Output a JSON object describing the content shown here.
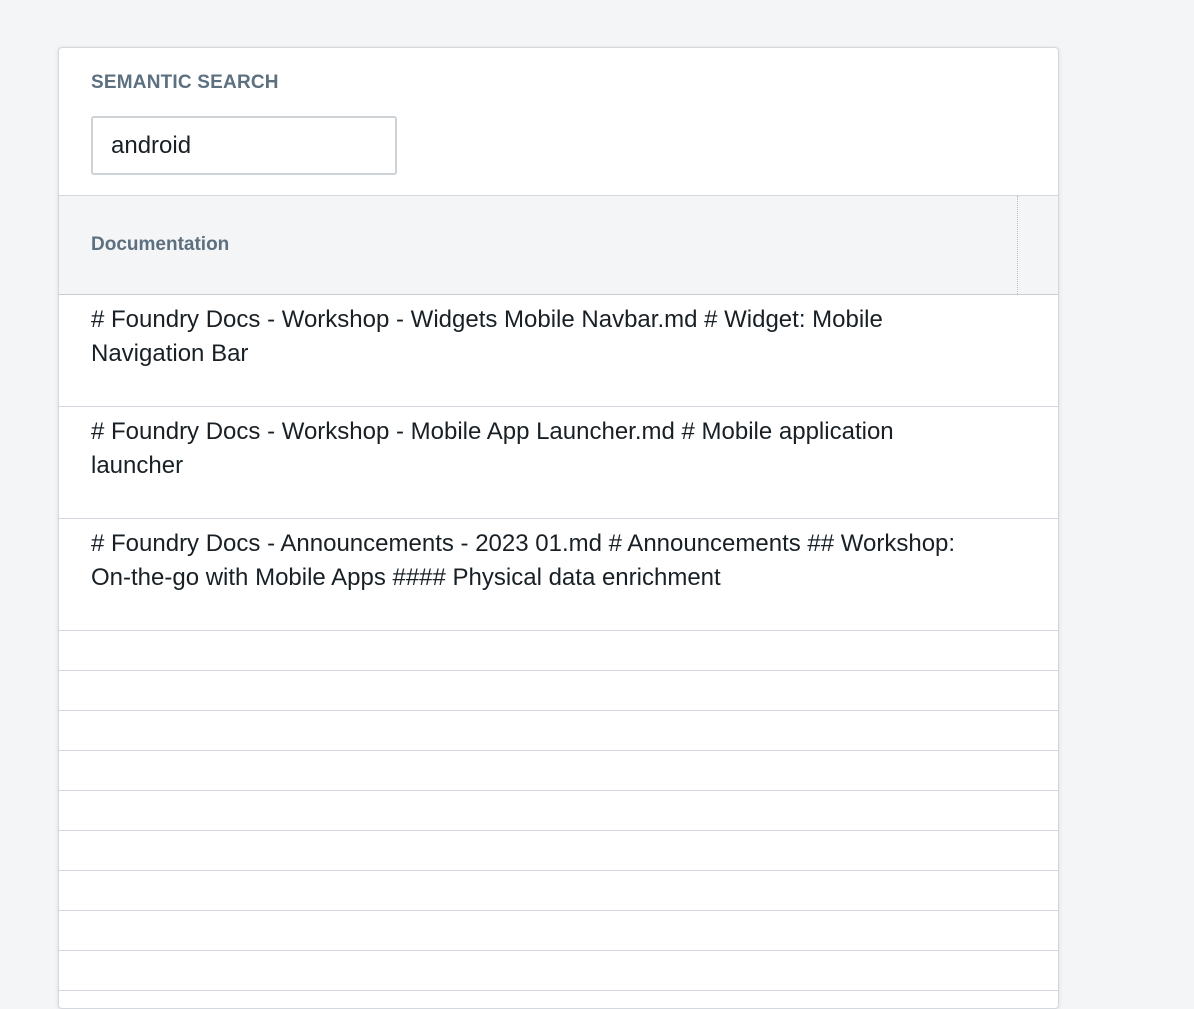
{
  "search": {
    "label": "SEMANTIC SEARCH",
    "value": "android"
  },
  "table": {
    "header": "Documentation",
    "rows": [
      {
        "text": "# Foundry Docs - Workshop - Widgets Mobile Navbar.md # Widget: Mobile Navigation Bar"
      },
      {
        "text": "# Foundry Docs - Workshop - Mobile App Launcher.md # Mobile application launcher"
      },
      {
        "text": "# Foundry Docs - Announcements - 2023 01.md # Announcements ## Workshop: On-the-go with Mobile Apps #### Physical data enrichment"
      }
    ]
  }
}
